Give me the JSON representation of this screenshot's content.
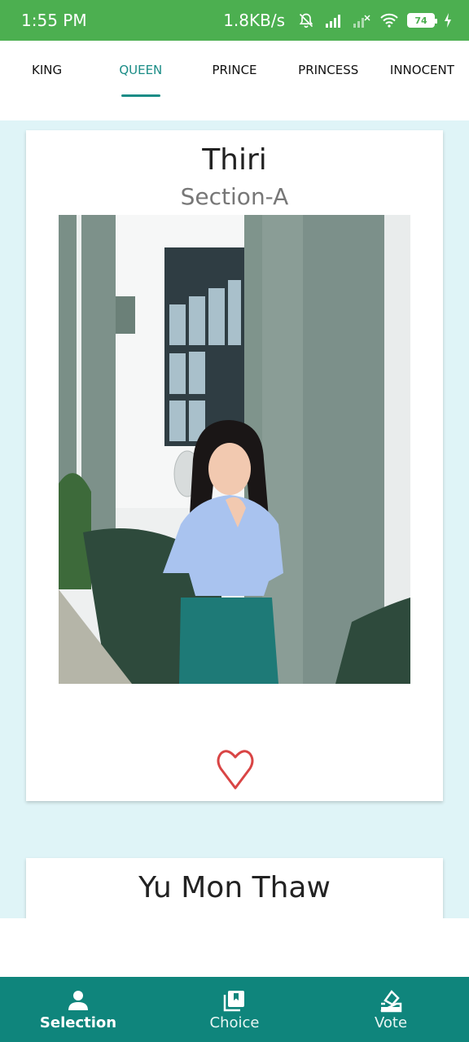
{
  "status_bar": {
    "time": "1:55 PM",
    "speed": "1.8KB/s",
    "battery": "74"
  },
  "tabs": [
    {
      "label": "KING"
    },
    {
      "label": "QUEEN"
    },
    {
      "label": "PRINCE"
    },
    {
      "label": "PRINCESS"
    },
    {
      "label": "INNOCENT"
    }
  ],
  "active_tab": "QUEEN",
  "cards": [
    {
      "name": "Thiri",
      "section": "Section-A"
    },
    {
      "name": "Yu Mon Thaw"
    }
  ],
  "bottom_nav": [
    {
      "label": "Selection",
      "icon": "person-icon"
    },
    {
      "label": "Choice",
      "icon": "photo-library-icon"
    },
    {
      "label": "Vote",
      "icon": "ballot-icon"
    }
  ],
  "colors": {
    "status_bar": "#4caf50",
    "accent": "#1a8c86",
    "content_bg": "#dff4f7",
    "bottom_nav": "#0f857c",
    "heart": "#d94545"
  }
}
